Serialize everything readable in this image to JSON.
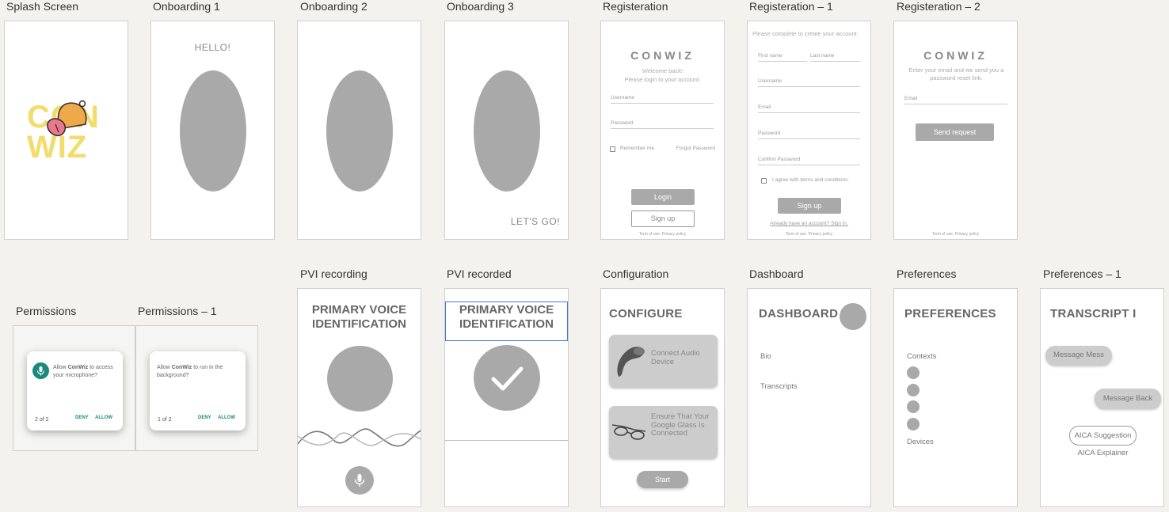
{
  "labels": {
    "splash": "Splash Screen",
    "onboarding1": "Onboarding 1",
    "onboarding2": "Onboarding 2",
    "onboarding3": "Onboarding 3",
    "registeration": "Registeration",
    "registeration1": "Registeration – 1",
    "registeration2": "Registeration – 2",
    "permissions": "Permissions",
    "permissions1": "Permissions – 1",
    "pvi_recording": "PVI recording",
    "pvi_recorded": "PVI recorded",
    "configuration": "Configuration",
    "dashboard": "Dashboard",
    "preferences": "Preferences",
    "preferences1": "Preferences – 1"
  },
  "splash": {
    "logo_line1": "CON",
    "logo_line2": "WIZ",
    "logo_color": "#f2dc6b"
  },
  "onboarding1": {
    "greeting": "HELLO!"
  },
  "onboarding3": {
    "cta": "LET'S GO!"
  },
  "registeration": {
    "logo": "CONWIZ",
    "welcome": "Welcome back!",
    "subtitle": "Please login to your account.",
    "username": "Username",
    "password": "Password",
    "remember": "Remember me",
    "forgot": "Forgot Password",
    "login": "Login",
    "signup": "Sign up",
    "terms": "Term of use. Privacy policy"
  },
  "registeration1": {
    "intro": "Please complete to create your account.",
    "first_name": "First name",
    "last_name": "Last name",
    "username": "Username",
    "email": "Email",
    "password": "Password",
    "confirm": "Confirm Password",
    "agree": "I agree with terms and conditions.",
    "signup": "Sign up",
    "have_account": "Already have an account? Sign in.",
    "terms": "Term of use. Privacy policy"
  },
  "registeration2": {
    "logo": "CONWIZ",
    "intro": "Enter your email and we send you a password reset link.",
    "email": "Email",
    "send": "Send request",
    "terms": "Term of use. Privacy policy"
  },
  "permissions": {
    "prefix": "Allow ",
    "app": "ConWiz",
    "suffix": " to access your microphone?",
    "count": "2 of 2",
    "deny": "DENY",
    "allow": "ALLOW",
    "accent": "#1a8a7b"
  },
  "permissions1": {
    "prefix": "Allow ",
    "app": "ConWiz",
    "suffix": " to run in the background?",
    "count": "1 of 2",
    "deny": "DENY",
    "allow": "ALLOW"
  },
  "pvi_recording": {
    "title_line1": "PRIMARY VOICE",
    "title_line2": "IDENTIFICATION"
  },
  "pvi_recorded": {
    "title_line1": "PRIMARY VOICE",
    "title_line2": "IDENTIFICATION"
  },
  "configuration": {
    "title": "CONFIGURE",
    "card1": "Connect Audio Device",
    "card2": "Ensure That Your Google Glass Is Connected",
    "start": "Start"
  },
  "dashboard": {
    "title": "DASHBOARD",
    "item1": "Bio",
    "item2": "Transcripts"
  },
  "preferences": {
    "title": "PREFERENCES",
    "contexts": "Contexts",
    "devices": "Devices"
  },
  "preferences1": {
    "title": "TRANSCRIPT I",
    "msg1": "Message Mess",
    "msg2": "Message Back",
    "suggestion": "AICA Suggestion",
    "explainer": "AICA Explainer"
  }
}
